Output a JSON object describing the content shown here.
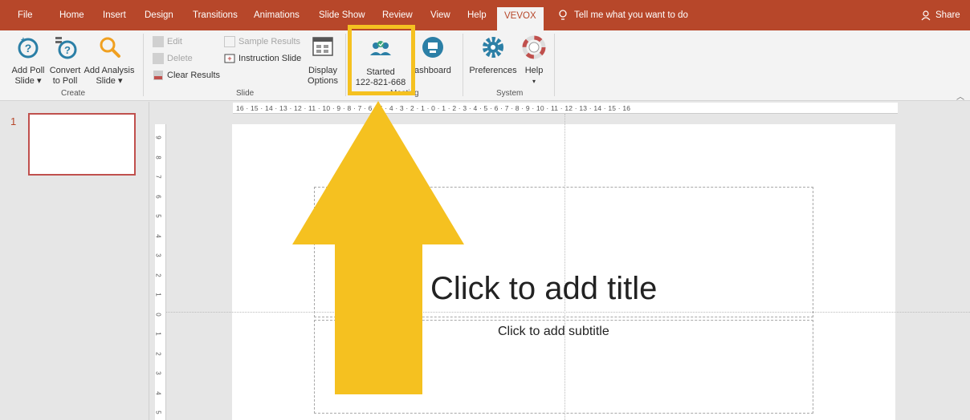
{
  "menu": {
    "tabs": [
      "File",
      "Home",
      "Insert",
      "Design",
      "Transitions",
      "Animations",
      "Slide Show",
      "Review",
      "View",
      "Help",
      "VEVOX"
    ],
    "active_tab": "VEVOX",
    "tell_me": "Tell me what you want to do",
    "share": "Share"
  },
  "ribbon": {
    "create": {
      "add_poll_1": "Add Poll",
      "add_poll_2": "Slide ▾",
      "convert_1": "Convert",
      "convert_2": "to Poll",
      "add_analysis_1": "Add Analysis",
      "add_analysis_2": "Slide ▾",
      "group_label": "Create"
    },
    "slide": {
      "edit": "Edit",
      "delete": "Delete",
      "clear_results": "Clear Results",
      "sample_results": "Sample Results",
      "instruction_slide": "Instruction Slide",
      "display_1": "Display",
      "display_2": "Options",
      "group_label": "Slide"
    },
    "meeting": {
      "started": "Started",
      "meeting_id": "122-821-668",
      "dashboard": "ashboard",
      "group_label": "Meeting"
    },
    "system": {
      "preferences": "Preferences",
      "help": "Help",
      "help_caret": "▾",
      "group_label": "System"
    },
    "collapse": "︿"
  },
  "slides_pane": {
    "slide_number": "1"
  },
  "ruler": {
    "horizontal": "16 · 15 · 14 · 13 · 12 · 11 · 10 · 9 · 8 · 7 · 6 · 5 · 4 · 3 · 2 · 1 · 0 · 1 · 2 · 3 · 4 · 5 · 6 · 7 · 8 · 9 · 10 · 11 · 12 · 13 · 14 · 15 · 16",
    "vertical": [
      "9",
      "8",
      "7",
      "6",
      "5",
      "4",
      "3",
      "2",
      "1",
      "0",
      "1",
      "2",
      "3",
      "4",
      "5"
    ]
  },
  "slide": {
    "title_placeholder": "Click to add title",
    "subtitle_placeholder": "Click to add subtitle"
  },
  "colors": {
    "accent": "#b7472a",
    "highlight": "#f5c120",
    "vevox_teal": "#2b7fa6"
  }
}
